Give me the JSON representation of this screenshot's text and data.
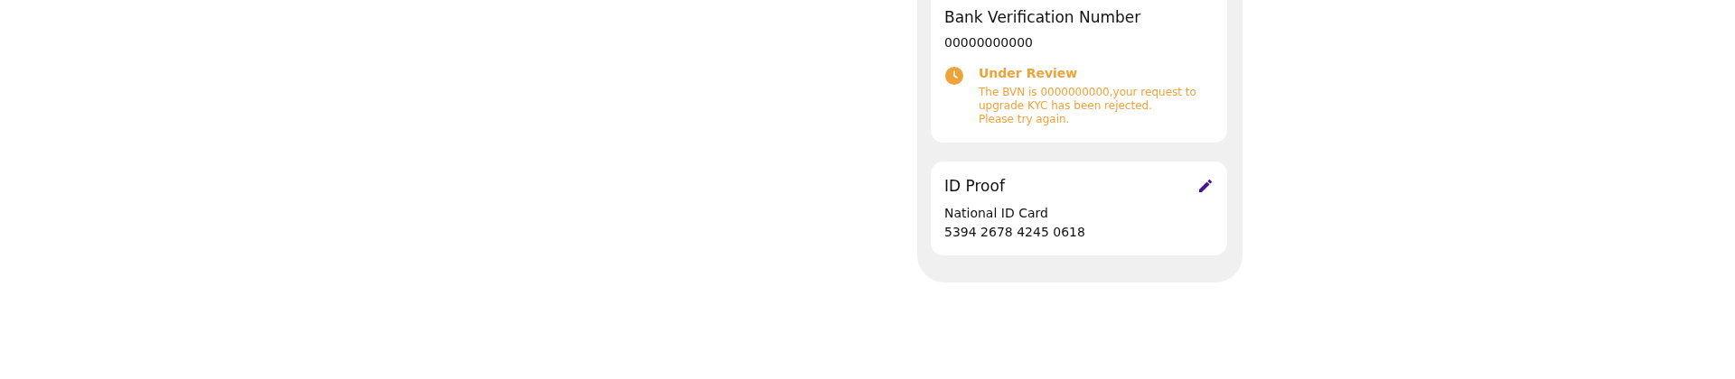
{
  "bvn_card": {
    "title": "Bank Verification Number",
    "value": "00000000000",
    "status": {
      "kind": "under_review",
      "label": "Under Review",
      "message_lines": [
        "The BVN is 0000000000,your request to upgrade KYC has been rejected.",
        "Please try again."
      ]
    }
  },
  "id_card": {
    "title": "ID Proof",
    "editable": true,
    "document_type": "National ID Card",
    "document_number": "5394 2678 4245 0618"
  }
}
